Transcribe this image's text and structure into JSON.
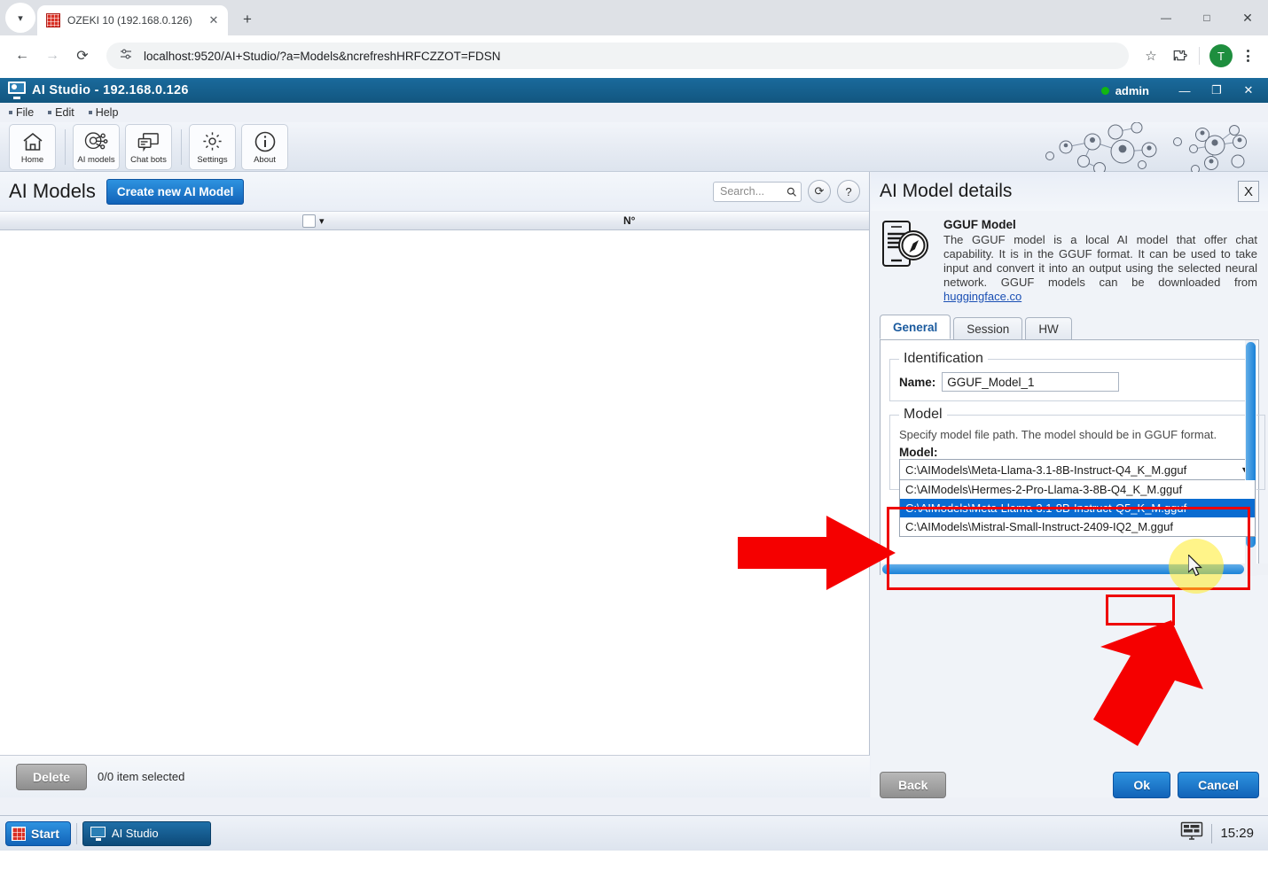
{
  "browser": {
    "tab": {
      "title": "OZEKI 10 (192.168.0.126)",
      "favicon": "ozeki-favicon"
    },
    "new_tab_label": "+",
    "url": "localhost:9520/AI+Studio/?a=Models&ncrefreshHRFCZZOT=FDSN",
    "nav": {
      "back": "←",
      "forward": "→",
      "reload": "⟳"
    },
    "window": {
      "minimize": "—",
      "maximize": "□",
      "close": "✕"
    },
    "profile_initial": "T",
    "icons": {
      "bookmark": "☆",
      "extensions": "puzzle-icon",
      "menu": "kebab-icon"
    }
  },
  "app": {
    "title": "AI Studio - 192.168.0.126",
    "user": "admin",
    "window": {
      "minimize": "—",
      "maximize": "❐",
      "close": "✕"
    },
    "menu": [
      "File",
      "Edit",
      "Help"
    ],
    "ribbon": [
      {
        "label": "Home",
        "icon": "home-icon"
      },
      {
        "label": "AI models",
        "icon": "ai-models-icon"
      },
      {
        "label": "Chat bots",
        "icon": "chat-bots-icon"
      },
      {
        "label": "Settings",
        "icon": "gear-icon"
      },
      {
        "label": "About",
        "icon": "info-icon"
      }
    ]
  },
  "models_panel": {
    "title": "AI Models",
    "create_button": "Create new AI Model",
    "search_placeholder": "Search...",
    "search_value": "",
    "refresh_icon": "refresh-icon",
    "help_icon": "help-icon",
    "columns": [
      "",
      "N°"
    ],
    "rows": [],
    "delete_button": "Delete",
    "selection_status": "0/0 item selected"
  },
  "details_panel": {
    "title": "AI Model details",
    "close_label": "X",
    "model_kind_title": "GGUF Model",
    "model_kind_desc": "The GGUF model is a local AI model that offer chat capability. It is in the GGUF format. It can be used to take input and convert it into an output using the selected neural network. GGUF models can be downloaded from ",
    "model_kind_link": "huggingface.co",
    "tabs": [
      {
        "label": "General",
        "active": true
      },
      {
        "label": "Session",
        "active": false
      },
      {
        "label": "HW",
        "active": false
      }
    ],
    "identification": {
      "legend": "Identification",
      "name_label": "Name:",
      "name_value": "GGUF_Model_1"
    },
    "model": {
      "legend": "Model",
      "help": "Specify model file path. The model should be in GGUF format.",
      "field_label": "Model:",
      "selected_value": "C:\\AIModels\\Meta-Llama-3.1-8B-Instruct-Q4_K_M.gguf",
      "dropdown_open": true,
      "options": [
        {
          "label": "C:\\AIModels\\Hermes-2-Pro-Llama-3-8B-Q4_K_M.gguf",
          "selected": false
        },
        {
          "label": "C:\\AIModels\\Meta-Llama-3.1-8B-Instruct-Q5_K_M.gguf",
          "selected": true
        },
        {
          "label": "C:\\AIModels\\Mistral-Small-Instruct-2409-IQ2_M.gguf",
          "selected": false
        }
      ]
    },
    "buttons": {
      "back": "Back",
      "ok": "Ok",
      "cancel": "Cancel"
    }
  },
  "taskbar": {
    "start": "Start",
    "start_icon": "start-icon",
    "items": [
      {
        "label": "AI Studio",
        "icon": "ai-studio-icon"
      }
    ],
    "tray_icon": "display-icon",
    "clock": "15:29"
  },
  "annotations": {
    "arrow_color": "#ee0000",
    "highlight_box_color": "#ee0000",
    "cursor_highlight_color": "#ffeb28"
  }
}
